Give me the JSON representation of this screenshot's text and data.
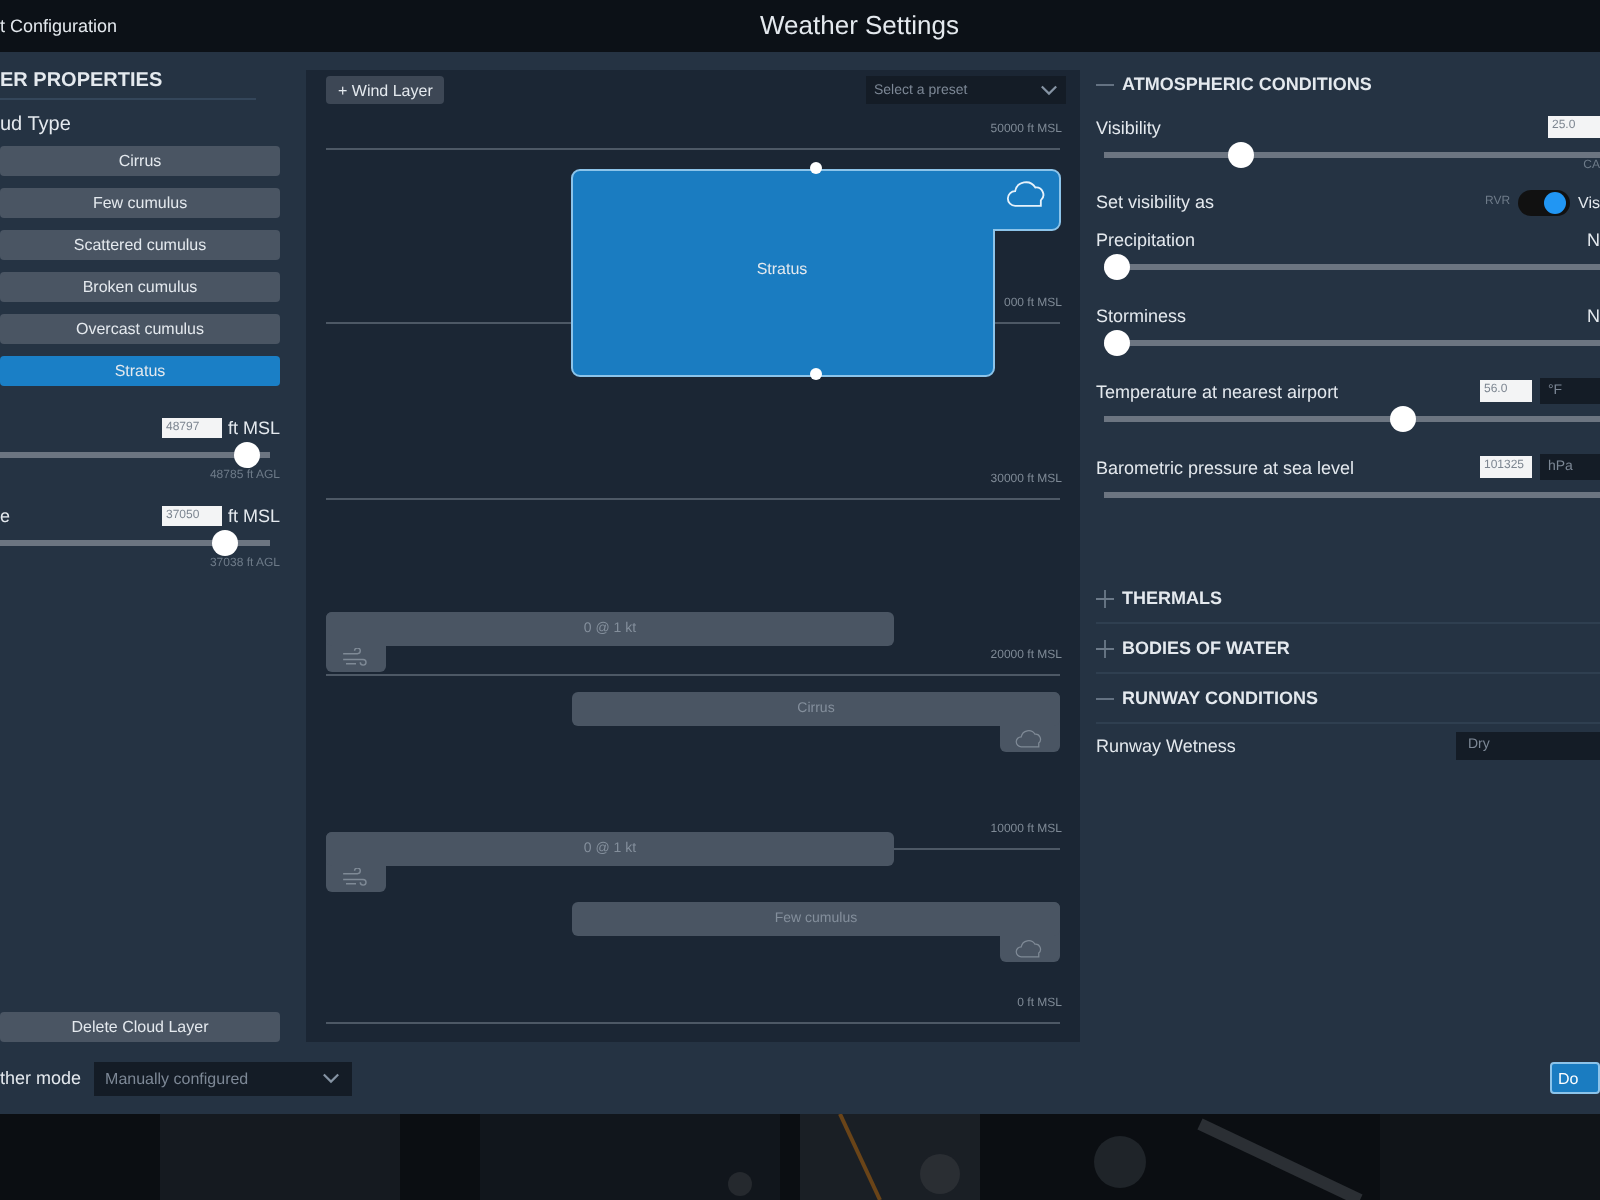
{
  "title_bar": {
    "left_text": "t Configuration",
    "title": "Weather Settings"
  },
  "layer_properties": {
    "heading": "ER PROPERTIES",
    "cloud_type_label": "ud Type",
    "cloud_types": [
      {
        "label": "Cirrus",
        "selected": false
      },
      {
        "label": "Few cumulus",
        "selected": false
      },
      {
        "label": "Scattered cumulus",
        "selected": false
      },
      {
        "label": "Broken cumulus",
        "selected": false
      },
      {
        "label": "Overcast cumulus",
        "selected": false
      },
      {
        "label": "Stratus",
        "selected": true
      }
    ],
    "altitudes": [
      {
        "value": "48797",
        "unit": "ft MSL",
        "level": 0.96,
        "agl": "48785 ft AGL"
      },
      {
        "label": "e",
        "value": "37050",
        "unit": "ft MSL",
        "level": 0.87,
        "agl": "37038 ft AGL"
      }
    ],
    "delete_button": "Delete Cloud Layer"
  },
  "layer_canvas": {
    "add_wind_button": "+ Wind Layer",
    "preset_placeholder": "Select a preset",
    "altitude_marks": [
      "50000 ft MSL",
      "000 ft MSL",
      "30000 ft MSL",
      "20000 ft MSL",
      "10000 ft MSL",
      "0 ft MSL"
    ],
    "layers": [
      {
        "kind": "cloud",
        "label": "Stratus",
        "selected": true
      },
      {
        "kind": "wind",
        "label": "0 @ 1 kt",
        "selected": false
      },
      {
        "kind": "cloud",
        "label": "Cirrus",
        "selected": false
      },
      {
        "kind": "wind",
        "label": "0 @ 1 kt",
        "selected": false
      },
      {
        "kind": "cloud",
        "label": "Few cumulus",
        "selected": false
      }
    ]
  },
  "atmospheric": {
    "heading": "ATMOSPHERIC CONDITIONS",
    "expanded": true,
    "rows": [
      {
        "kind": "slider",
        "label": "Visibility",
        "value": "25.0",
        "level": 0.26,
        "note": "CA"
      },
      {
        "kind": "toggle",
        "label": "Set visibility as",
        "off_label": "RVR",
        "on": true,
        "on_label": "Vis"
      },
      {
        "kind": "slider",
        "label": "Precipitation",
        "reading": "N",
        "level": 0
      },
      {
        "kind": "slider",
        "label": "Storminess",
        "reading": "N",
        "level": 0
      },
      {
        "kind": "slider",
        "label": "Temperature at nearest airport",
        "value": "56.0",
        "unit": "°F",
        "level": 0.6
      },
      {
        "kind": "slider",
        "label": "Barometric pressure at sea level",
        "value": "101325",
        "unit": "hPa"
      }
    ]
  },
  "sections": [
    {
      "title": "THERMALS",
      "expanded": false
    },
    {
      "title": "BODIES OF WATER",
      "expanded": false
    },
    {
      "title": "RUNWAY CONDITIONS",
      "expanded": true,
      "fields": [
        {
          "label": "Runway Wetness",
          "value": "Dry"
        }
      ]
    }
  ],
  "footer": {
    "mode_label": "ther mode",
    "mode_value": "Manually configured",
    "done_button": "Do"
  }
}
